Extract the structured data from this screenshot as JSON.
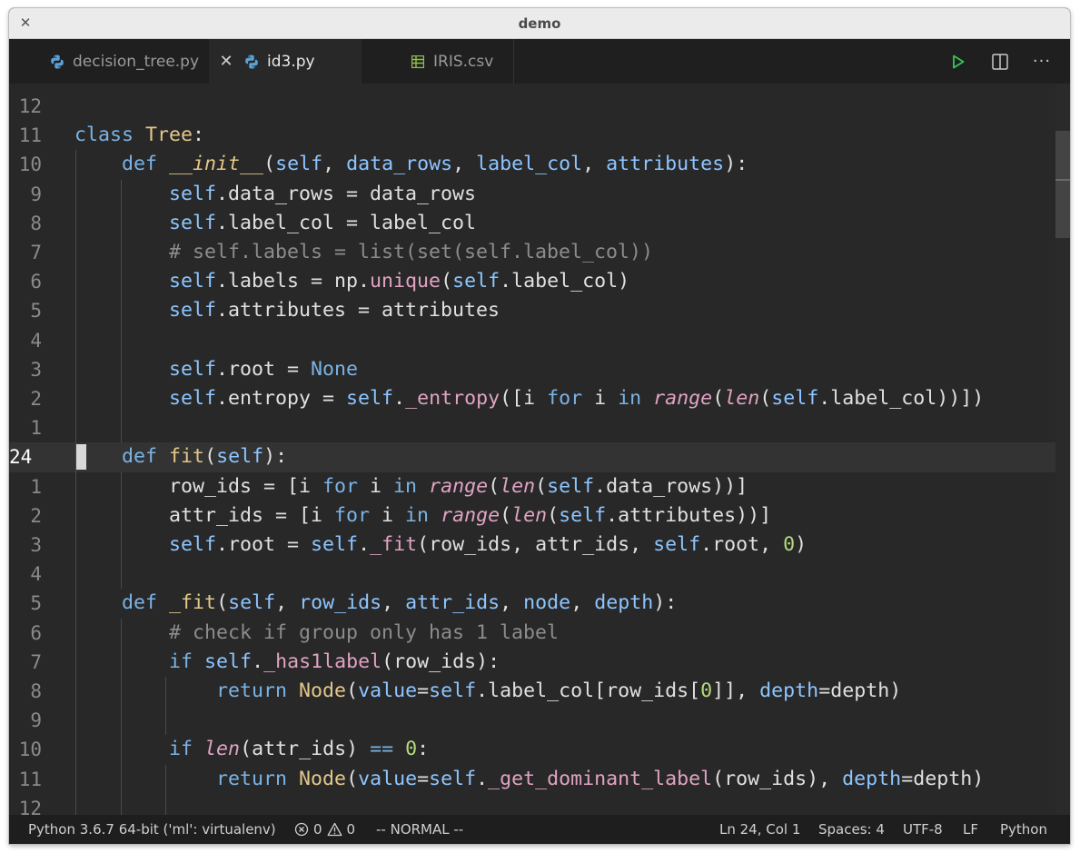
{
  "window": {
    "title": "demo"
  },
  "tabs": [
    {
      "label": "decision_tree.py",
      "icon": "python-file-icon"
    },
    {
      "label": "id3.py",
      "icon": "python-file-icon",
      "active": true
    },
    {
      "label": "IRIS.csv",
      "icon": "csv-file-icon"
    }
  ],
  "editor_actions": [
    "run-icon",
    "split-editor-icon",
    "more-actions-icon"
  ],
  "gutter": [
    "12",
    "11",
    "10",
    "9",
    "8",
    "7",
    "6",
    "5",
    "4",
    "3",
    "2",
    "1",
    "24",
    "1",
    "2",
    "3",
    "4",
    "5",
    "6",
    "7",
    "8",
    "9",
    "10",
    "11",
    "12"
  ],
  "current_line_index": 12,
  "code_lines": [
    "",
    "class Tree:",
    "    def __init__(self, data_rows, label_col, attributes):",
    "        self.data_rows = data_rows",
    "        self.label_col = label_col",
    "        # self.labels = list(set(self.label_col))",
    "        self.labels = np.unique(self.label_col)",
    "        self.attributes = attributes",
    "",
    "        self.root = None",
    "        self.entropy = self._entropy([i for i in range(len(self.label_col))])",
    "",
    "    def fit(self):",
    "        row_ids = [i for i in range(len(self.data_rows))]",
    "        attr_ids = [i for i in range(len(self.attributes))]",
    "        self.root = self._fit(row_ids, attr_ids, self.root, 0)",
    "",
    "    def _fit(self, row_ids, attr_ids, node, depth):",
    "        # check if group only has 1 label",
    "        if self._has1label(row_ids):",
    "            return Node(value=self.label_col[row_ids[0]], depth=depth)",
    "",
    "        if len(attr_ids) == 0:",
    "            return Node(value=self._get_dominant_label(row_ids), depth=depth)",
    ""
  ],
  "status": {
    "interpreter": "Python 3.6.7 64-bit ('ml': virtualenv)",
    "errors": "0",
    "warnings": "0",
    "mode": "-- NORMAL --",
    "position": "Ln 24, Col 1",
    "spaces": "Spaces: 4",
    "encoding": "UTF-8",
    "eol": "LF",
    "language": "Python"
  },
  "colors": {
    "editor_bg": "#282828",
    "keyword": "#7ab3e6",
    "class_function": "#e3c78a",
    "self_param": "#8dc5ff",
    "comment": "#8c8c8c",
    "number": "#b5d97d",
    "builtin_call": "#e0a3c2",
    "run_icon": "#37c859",
    "csv_icon": "#8fbf4a"
  }
}
